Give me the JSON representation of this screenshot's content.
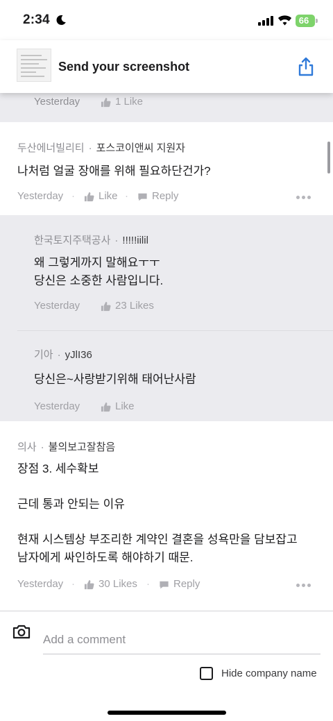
{
  "status_bar": {
    "time": "2:34",
    "battery_level": "66"
  },
  "banner": {
    "title": "Send your screenshot"
  },
  "comments": {
    "top_partial": {
      "time": "Yesterday",
      "likes": "1 Like"
    },
    "c1": {
      "company": "두산에너빌리티",
      "role": "포스코이앤씨 지원자",
      "text": "나처럼 얼굴 장애를 위해 필요하단건가?",
      "time": "Yesterday",
      "likes": "Like",
      "reply": "Reply"
    },
    "r1": {
      "company": "한국토지주택공사",
      "user": "!!!!!iilil",
      "text1": "왜 그렇게까지 말해요ㅜㅜ",
      "text2": "당신은 소중한 사람입니다.",
      "time": "Yesterday",
      "likes": "23 Likes"
    },
    "r2": {
      "company": "기아",
      "user": "yJlI36",
      "text": "당신은~사랑받기위해 태어난사람",
      "time": "Yesterday",
      "likes": "Like"
    },
    "c2": {
      "company": "의사",
      "user": "불의보고잘참음",
      "line1": "장점 3. 세수확보",
      "line2": "근데 통과 안되는 이유",
      "line3": "현재 시스템상 부조리한 계약인 결혼을 성욕만을 담보잡고",
      "line4": "남자에게 싸인하도록 해야하기 때문.",
      "time": "Yesterday",
      "likes": "30 Likes",
      "reply": "Reply"
    }
  },
  "composer": {
    "placeholder": "Add a comment",
    "hide_company_label": "Hide company name"
  },
  "colors": {
    "grey_background": "#ebebef",
    "battery": "#7ed36b",
    "accent": "#2f7ad9"
  }
}
